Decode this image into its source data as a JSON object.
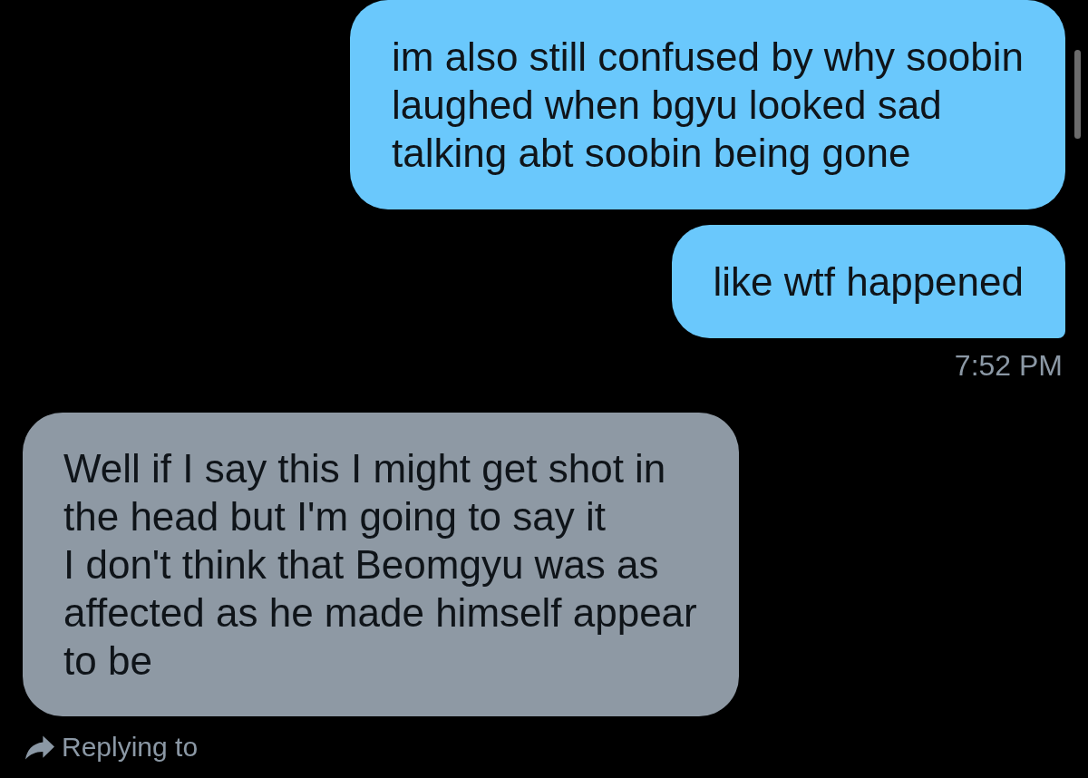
{
  "messages": [
    {
      "kind": "sent",
      "text": "im also still confused by why soobin\nlaughed when bgyu looked sad\ntalking abt soobin being gone"
    },
    {
      "kind": "sent",
      "text": "like wtf happened",
      "timestamp": "7:52 PM"
    },
    {
      "kind": "received",
      "text": "Well if I say this I might get shot in\nthe head but I'm going to say it\nI don't think that Beomgyu was as\naffected as he made himself appear\nto be"
    }
  ],
  "reply_context": {
    "label": "Replying to"
  }
}
